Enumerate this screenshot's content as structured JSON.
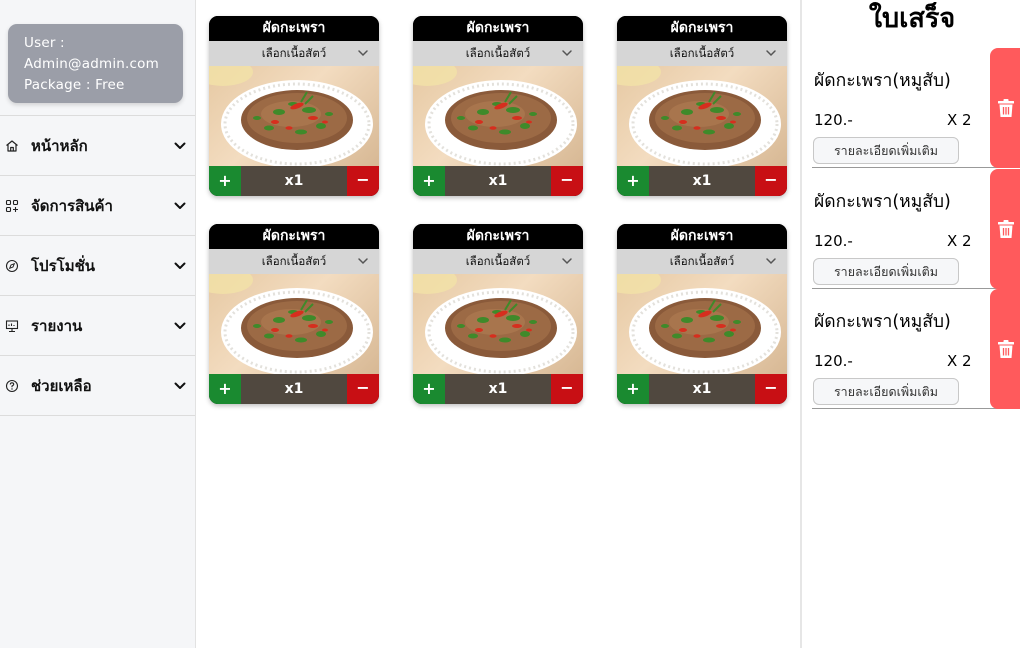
{
  "user": {
    "line1": "User :",
    "line2": "Admin@admin.com",
    "line3": "Package : Free"
  },
  "menu": [
    {
      "label": "หน้าหลัก",
      "icon": "home-icon"
    },
    {
      "label": "จัดการสินค้า",
      "icon": "grid-plus-icon"
    },
    {
      "label": "โปรโมชั่น",
      "icon": "compass-icon"
    },
    {
      "label": "รายงาน",
      "icon": "monitor-icon"
    },
    {
      "label": "ช่วยเหลือ",
      "icon": "help-circle-icon"
    }
  ],
  "products": [
    {
      "name": "ผัดกะเพรา",
      "select": "เลือกเนื้อสัตว์",
      "qty": "x1",
      "plus": "+",
      "minus": "−"
    },
    {
      "name": "ผัดกะเพรา",
      "select": "เลือกเนื้อสัตว์",
      "qty": "x1",
      "plus": "+",
      "minus": "−"
    },
    {
      "name": "ผัดกะเพรา",
      "select": "เลือกเนื้อสัตว์",
      "qty": "x1",
      "plus": "+",
      "minus": "−"
    },
    {
      "name": "ผัดกะเพรา",
      "select": "เลือกเนื้อสัตว์",
      "qty": "x1",
      "plus": "+",
      "minus": "−"
    },
    {
      "name": "ผัดกะเพรา",
      "select": "เลือกเนื้อสัตว์",
      "qty": "x1",
      "plus": "+",
      "minus": "−"
    },
    {
      "name": "ผัดกะเพรา",
      "select": "เลือกเนื้อสัตว์",
      "qty": "x1",
      "plus": "+",
      "minus": "−"
    }
  ],
  "receipt": {
    "title": "ใบเสร็จ",
    "items": [
      {
        "name": "ผัดกะเพรา(หมูสับ)",
        "price": "120.-",
        "qty": "X 2",
        "detail": "รายละเอียดเพิ่มเติม"
      },
      {
        "name": "ผัดกะเพรา(หมูสับ)",
        "price": "120.-",
        "qty": "X 2",
        "detail": "รายละเอียดเพิ่มเติม"
      },
      {
        "name": "ผัดกะเพรา(หมูสับ)",
        "price": "120.-",
        "qty": "X 2",
        "detail": "รายละเอียดเพิ่มเติม"
      }
    ]
  },
  "colors": {
    "plus": "#1a8a30",
    "minus": "#c80f14",
    "delete": "#ff5a5c",
    "user_card": "#9b9ea8"
  }
}
